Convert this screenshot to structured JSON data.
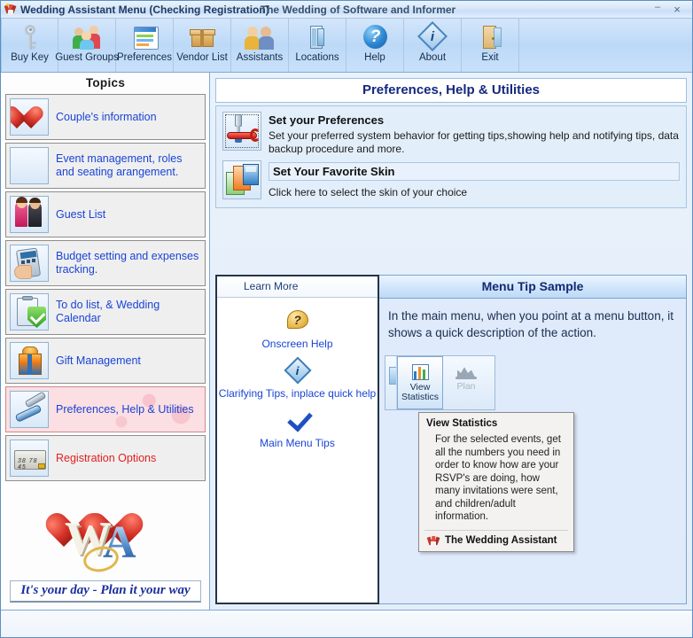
{
  "window": {
    "title_left": "Wedding Assistant Menu (Checking Registration)",
    "title_center": "The Wedding of Software and Informer",
    "app_icon": "wedding-bouquet-icon",
    "minimize": "–",
    "close": "×"
  },
  "toolbar": {
    "buttons": [
      {
        "label": "Buy Key",
        "icon": "key-icon"
      },
      {
        "label": "Guest Groups",
        "icon": "people-group-icon"
      },
      {
        "label": "Preferences",
        "icon": "window-settings-icon"
      },
      {
        "label": "Vendor List",
        "icon": "box-icon"
      },
      {
        "label": "Assistants",
        "icon": "two-people-icon"
      },
      {
        "label": "Locations",
        "icon": "door-icon"
      },
      {
        "label": "Help",
        "icon": "question-circle-icon"
      },
      {
        "label": "About",
        "icon": "info-diamond-icon"
      },
      {
        "label": "Exit",
        "icon": "exit-door-icon"
      }
    ]
  },
  "sidebar": {
    "header": "Topics",
    "items": [
      {
        "label": "Couple's information",
        "icon": "heart-icon",
        "selected": false,
        "red": false
      },
      {
        "label": "Event management, roles and seating arangement.",
        "icon": "champagne-glasses-icon",
        "selected": false,
        "red": false
      },
      {
        "label": "Guest List",
        "icon": "couple-photo-icon",
        "selected": false,
        "red": false
      },
      {
        "label": "Budget setting and expenses tracking.",
        "icon": "calculator-icon",
        "selected": false,
        "red": false
      },
      {
        "label": "To do list, & Wedding Calendar",
        "icon": "clipboard-check-icon",
        "selected": false,
        "red": false
      },
      {
        "label": "Gift Management",
        "icon": "gift-icon",
        "selected": false,
        "red": false
      },
      {
        "label": "Preferences, Help & Utilities",
        "icon": "tools-icon",
        "selected": true,
        "red": false
      },
      {
        "label": "Registration Options",
        "icon": "credit-card-icon",
        "selected": false,
        "red": true
      }
    ],
    "logo": {
      "letters_w": "W",
      "letters_a": "A",
      "tagline": "It's your day - Plan it your way"
    }
  },
  "content": {
    "page_title": "Preferences, Help & Utilities",
    "preference_rows": [
      {
        "heading": "Set your Preferences",
        "description": "Set your preferred system behavior for getting tips,showing help and notifying tips, data backup procedure and more.",
        "icon": "wrench-screwdriver-icon"
      },
      {
        "heading": "Set Your Favorite Skin",
        "description": "Click here to select the skin of your choice",
        "icon": "skins-icon"
      }
    ],
    "learn_more": {
      "header": "Learn More",
      "items": [
        {
          "label": "Onscreen Help",
          "icon": "question-bubble-icon"
        },
        {
          "label": "Clarifying Tips, inplace quick help",
          "icon": "info-diamond-icon"
        },
        {
          "label": "Main Menu Tips",
          "icon": "check-mark-icon"
        }
      ]
    },
    "menu_tip": {
      "header": "Menu Tip Sample",
      "text": "In the main menu, when you point at a menu button, it shows a quick description of the action.",
      "mini_toolbar": [
        {
          "label": "View Statistics",
          "icon": "bar-chart-icon",
          "selected": true
        },
        {
          "label": "Plan",
          "icon": "crown-icon",
          "selected": false
        }
      ],
      "tooltip": {
        "title": "View Statistics",
        "body": "For the selected events, get all the numbers you need in order to know how are your RSVP's are doing, how many invitations were sent, and children/adult information.",
        "footer": "The Wedding Assistant",
        "footer_icon": "wedding-bouquet-icon"
      }
    }
  },
  "colors": {
    "accent_blue": "#1a44d6",
    "title_navy": "#14287e",
    "selected_pink": "#fcdfe2",
    "red_text": "#e21f1f"
  }
}
